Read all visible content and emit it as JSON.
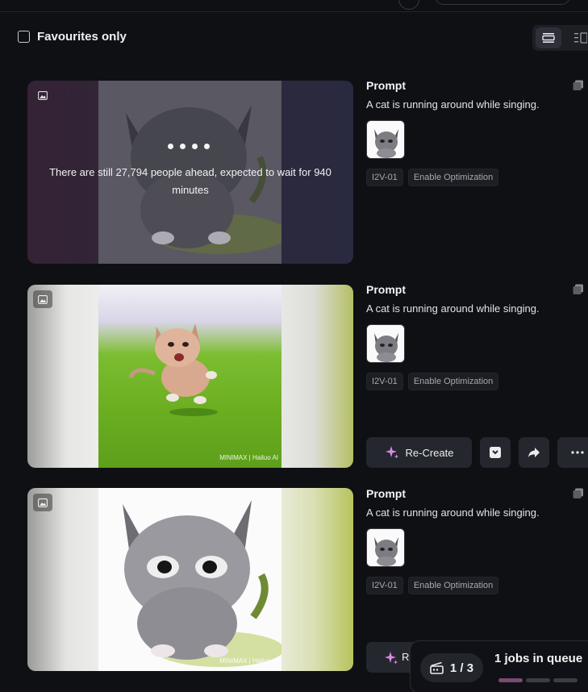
{
  "filter": {
    "label": "Favourites only",
    "checked": false
  },
  "view_toggle": {
    "options": [
      "list-view",
      "grid-view"
    ],
    "active": "list-view"
  },
  "cards": [
    {
      "status": "queued",
      "queue_message": "There are still 27,794 people ahead, expected to wait for 940 minutes",
      "prompt_title": "Prompt",
      "prompt_text": "A cat is running around while singing.",
      "tags": [
        "I2V-01",
        "Enable Optimization"
      ]
    },
    {
      "status": "done",
      "watermark": "MINIMAX | Hailuo AI",
      "prompt_title": "Prompt",
      "prompt_text": "A cat is running around while singing.",
      "tags": [
        "I2V-01",
        "Enable Optimization"
      ],
      "actions": {
        "recreate_label": "Re-Create"
      }
    },
    {
      "status": "done",
      "watermark": "MINIMAX | Hailuo AI",
      "prompt_title": "Prompt",
      "prompt_text": "A cat is running around while singing.",
      "tags": [
        "I2V-01",
        "Enable Optimization"
      ],
      "actions": {
        "recreate_label": "R"
      }
    }
  ],
  "queue_panel": {
    "counter": "1 / 3",
    "label": "1 jobs in queue",
    "progress_segments_done": 1,
    "progress_segments_total": 3
  },
  "colors": {
    "background": "#0f1014",
    "accent_sparkle": "#d78be6",
    "button": "#25272e"
  }
}
